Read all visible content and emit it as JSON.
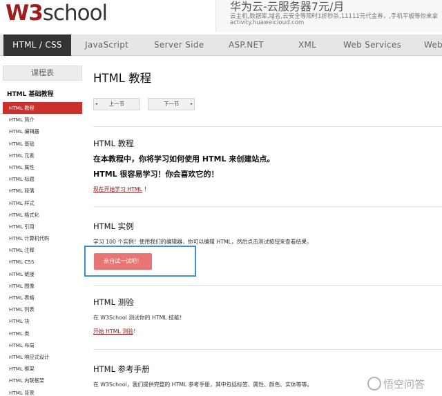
{
  "logo": {
    "w3": "W3",
    "school": "school"
  },
  "ad": {
    "title": "华为云-云服务器7元/月",
    "desc": "云主机,数据库,域名,云安全等限时1折秒杀,11111元代金券，,手机平板等你来拿",
    "url": "activity.huaweicloud.com"
  },
  "nav": [
    "HTML / CSS",
    "JavaScript",
    "Server Side",
    "ASP.NET",
    "XML",
    "Web Services",
    "Web"
  ],
  "sidebar": {
    "heading": "课程表",
    "section": "HTML 基础教程",
    "items": [
      "HTML 教程",
      "HTML 简介",
      "HTML 编辑器",
      "HTML 基础",
      "HTML 元素",
      "HTML 属性",
      "HTML 标题",
      "HTML 段落",
      "HTML 样式",
      "HTML 格式化",
      "HTML 引用",
      "HTML 计算机代码",
      "HTML 注释",
      "HTML CSS",
      "HTML 链接",
      "HTML 图像",
      "HTML 表格",
      "HTML 列表",
      "HTML 块",
      "HTML 类",
      "HTML 布局",
      "HTML 响应式设计",
      "HTML 框架",
      "HTML 内联框架",
      "HTML 背景"
    ]
  },
  "main": {
    "title": "HTML 教程",
    "prev": "上一节",
    "next": "下一节",
    "s1": {
      "heading": "HTML 教程",
      "line1": "在本教程中，你将学习如何使用 HTML 来创建站点。",
      "line2": "HTML 很容易学习！你会喜欢它的！",
      "link": "现在开始学习 HTML",
      "link_suffix": "！"
    },
    "s2": {
      "heading": "HTML 实例",
      "text": "学习 100 个实例！使用我们的编辑器，你可以编辑 HTML，然后点击测试按钮来查看结果。",
      "button": "亲自试一试吧！"
    },
    "s3": {
      "heading": "HTML 测验",
      "text": "在 W3School 测试你的 HTML 技能！",
      "link": "开始 HTML 测验",
      "link_suffix": "！"
    },
    "s4": {
      "heading": "HTML 参考手册",
      "text": "在 W3School，我们提供完整的 HTML 参考手册，其中包括标签、属性、颜色、实体等等。"
    }
  },
  "watermark": "悟空问答",
  "colors": {
    "active_nav": "#333333",
    "active_side": "#c9302c",
    "try_button": "#e87474",
    "logo_w3": "#a01d1d",
    "focus": "#3b8fd6"
  }
}
